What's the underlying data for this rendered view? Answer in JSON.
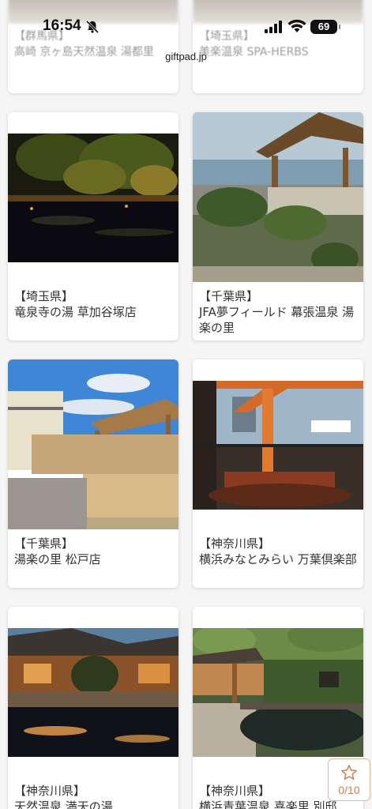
{
  "status_bar": {
    "time": "16:54",
    "battery": "69"
  },
  "site": {
    "url": "giftpad.jp"
  },
  "top_cards": [
    {
      "prefecture": "【群馬県】",
      "name": "高崎 京ヶ島天然温泉 湯都里"
    },
    {
      "prefecture": "【埼玉県】",
      "name": "美楽温泉 SPA-HERBS"
    }
  ],
  "cards": [
    {
      "prefecture": "【埼玉県】",
      "name": "竜泉寺の湯 草加谷塚店",
      "photo_icon": "night-garden-bath-photo"
    },
    {
      "prefecture": "【千葉県】",
      "name": "JFA夢フィールド 幕張温泉 湯楽の里",
      "photo_icon": "seaside-terrace-photo"
    },
    {
      "prefecture": "【千葉県】",
      "name": "湯楽の里 松戸店",
      "photo_icon": "open-air-deck-photo"
    },
    {
      "prefecture": "【神奈川県】",
      "name": "横浜みなとみらい 万葉倶楽部",
      "photo_icon": "harbor-view-bath-photo"
    },
    {
      "prefecture": "【神奈川県】",
      "name": "天然温泉 満天の湯",
      "photo_icon": "night-ryokan-bath-photo"
    },
    {
      "prefecture": "【神奈川県】",
      "name": "横浜青葉温泉 喜楽里 別邸",
      "photo_icon": "garden-bath-photo"
    }
  ],
  "favorites": {
    "count_label": "0/10"
  },
  "colors": {
    "accent": "#d08050",
    "background": "#f5f5f5"
  }
}
